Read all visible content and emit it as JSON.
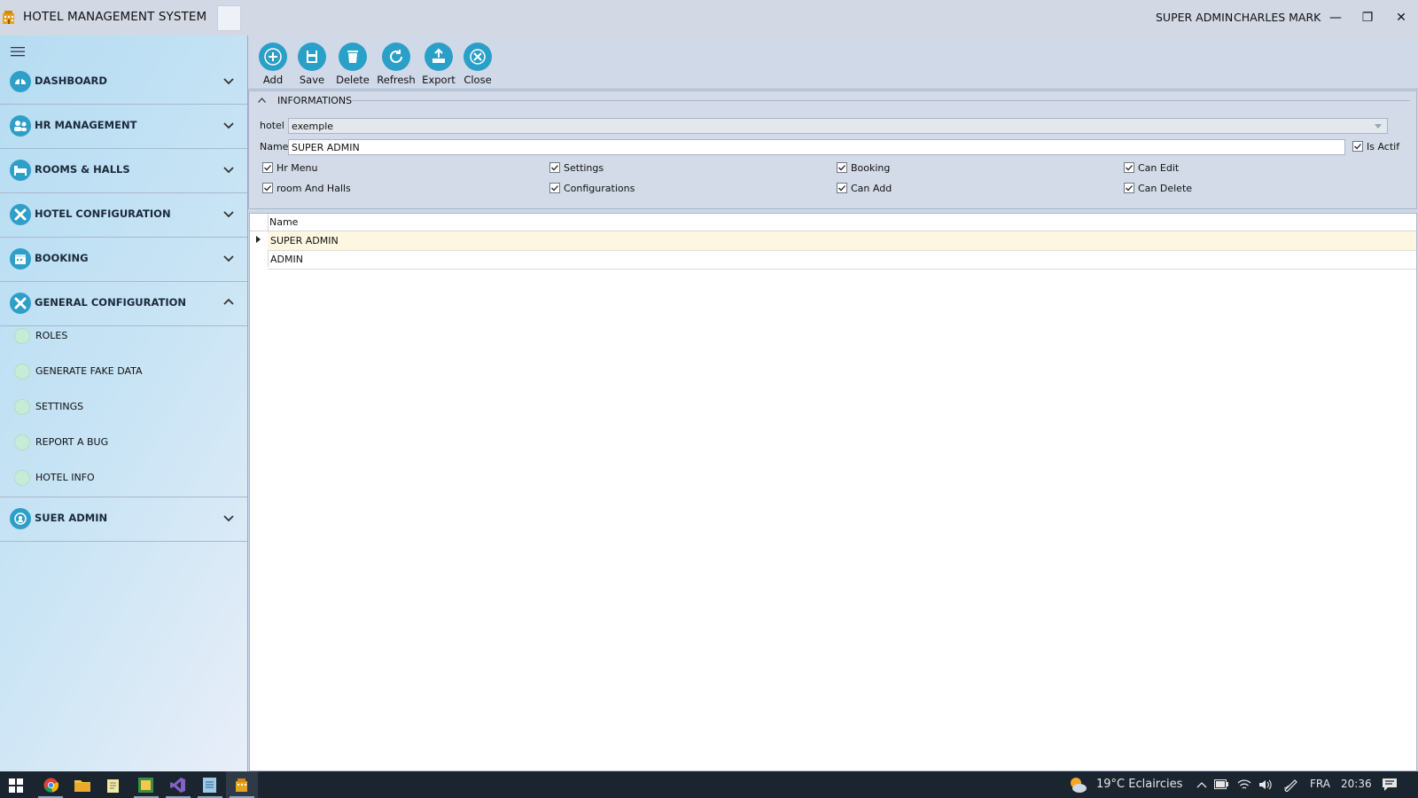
{
  "app": {
    "title": "HOTEL MANAGEMENT SYSTEM",
    "user_role": "SUPER ADMIN",
    "user_name": "CHARLES MARK",
    "minimize_glyph": "—",
    "restore_glyph": "❐",
    "close_glyph": "✕"
  },
  "sidebar": {
    "menu_icon": "hamburger-icon",
    "items": [
      {
        "label": "DASHBOARD",
        "icon": "dashboard-icon",
        "expanded": false
      },
      {
        "label": "HR MANAGEMENT",
        "icon": "users-icon",
        "expanded": false
      },
      {
        "label": "ROOMS & HALLS",
        "icon": "bed-icon",
        "expanded": false
      },
      {
        "label": "HOTEL CONFIGURATION",
        "icon": "tools-icon",
        "expanded": false
      },
      {
        "label": "BOOKING",
        "icon": "calendar-icon",
        "expanded": false
      },
      {
        "label": "GENERAL CONFIGURATION",
        "icon": "tools-icon",
        "expanded": true
      },
      {
        "label": "SUER ADMIN",
        "icon": "user-icon",
        "expanded": false
      }
    ],
    "sub_items": [
      {
        "label": "ROLES",
        "icon": "plus-circle-icon"
      },
      {
        "label": "GENERATE FAKE DATA",
        "icon": "plus-circle-icon"
      },
      {
        "label": "SETTINGS",
        "icon": "plus-circle-icon"
      },
      {
        "label": "REPORT A BUG",
        "icon": "plus-circle-icon"
      },
      {
        "label": "HOTEL INFO",
        "icon": "plus-circle-icon"
      }
    ]
  },
  "toolbar": {
    "buttons": [
      {
        "label": "Add",
        "icon": "add-icon"
      },
      {
        "label": "Save",
        "icon": "save-icon"
      },
      {
        "label": "Delete",
        "icon": "delete-icon"
      },
      {
        "label": "Refresh",
        "icon": "refresh-icon"
      },
      {
        "label": "Export",
        "icon": "export-icon"
      },
      {
        "label": "Close",
        "icon": "close-icon"
      }
    ]
  },
  "info": {
    "header": "INFORMATIONS",
    "hotel_label": "hotel",
    "hotel_value": "exemple",
    "name_label": "Name",
    "name_value": "SUPER ADMIN",
    "is_actif_label": "Is Actif",
    "is_actif_checked": true,
    "permissions": [
      {
        "label": "Hr Menu",
        "checked": true
      },
      {
        "label": "Settings",
        "checked": true
      },
      {
        "label": "Booking",
        "checked": true
      },
      {
        "label": "Can Edit",
        "checked": true
      },
      {
        "label": "room And Halls",
        "checked": true
      },
      {
        "label": "Configurations",
        "checked": true
      },
      {
        "label": "Can Add",
        "checked": true
      },
      {
        "label": "Can Delete",
        "checked": true
      }
    ]
  },
  "grid": {
    "columns": [
      "Name"
    ],
    "rows": [
      {
        "name": "SUPER ADMIN",
        "selected": true
      },
      {
        "name": "ADMIN",
        "selected": false
      }
    ],
    "selected_color": "#fdf6e0"
  },
  "taskbar": {
    "apps": [
      "windows-start-icon",
      "chrome-icon",
      "file-explorer-icon",
      "notepad-icon",
      "app-icon",
      "visual-studio-icon",
      "notes-icon",
      "hotel-app-icon"
    ],
    "weather": "19°C  Eclaircies",
    "language": "FRA",
    "time": "20:36"
  },
  "colors": {
    "accent": "#2a9fc7",
    "titlebar": "#d3d8e5",
    "taskbar": "#1b2530"
  }
}
